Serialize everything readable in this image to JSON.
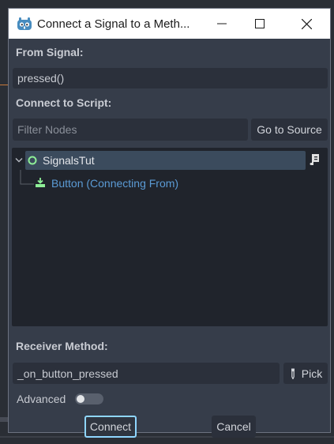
{
  "window": {
    "title": "Connect a Signal to a Meth...",
    "icons": {
      "app": "godot-icon",
      "minimize": "minimize-icon",
      "maximize": "maximize-icon",
      "close": "close-icon"
    }
  },
  "from_signal": {
    "label": "From Signal:",
    "value": "pressed()"
  },
  "connect_to_script": {
    "label": "Connect to Script:",
    "filter_placeholder": "Filter Nodes",
    "go_to_source": "Go to Source"
  },
  "tree": {
    "root": {
      "label": "SignalsTut",
      "icon": "node-circle-icon",
      "script_icon": "script-icon"
    },
    "child": {
      "label": "Button (Connecting From)",
      "icon": "button-node-icon"
    }
  },
  "receiver": {
    "label": "Receiver Method:",
    "value": "_on_button_pressed",
    "pick": "Pick",
    "pick_icon": "eyedropper-icon"
  },
  "advanced": {
    "label": "Advanced",
    "enabled": false
  },
  "footer": {
    "connect": "Connect",
    "cancel": "Cancel"
  },
  "colors": {
    "accent": "#8fd6ff",
    "node_green": "#8eef97",
    "link_blue": "#5b9bd5",
    "panel": "#363d4a"
  }
}
